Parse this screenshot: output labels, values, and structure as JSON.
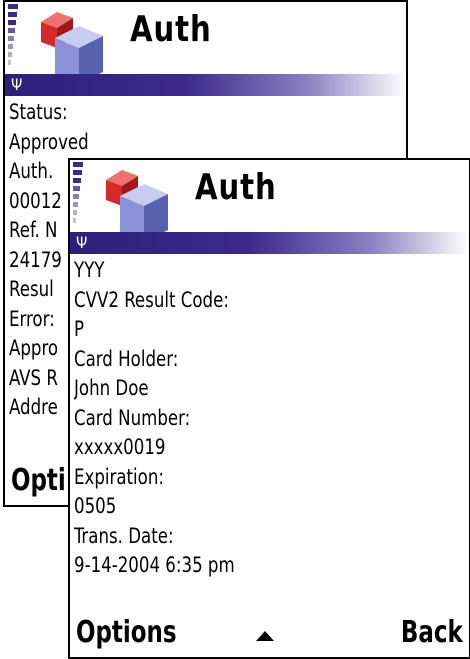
{
  "back_screen": {
    "title": "Auth",
    "lines": [
      "Status:",
      "Approved",
      "Auth.",
      "00012",
      "Ref. N",
      "24179",
      "Resul",
      "Error:",
      "Appro",
      "AVS R",
      "Addre"
    ],
    "softkey_left": "Opti"
  },
  "front_screen": {
    "title": "Auth",
    "lines": [
      "YYY",
      "CVV2 Result Code:",
      "P",
      "Card Holder:",
      "John Doe",
      "Card Number:",
      "xxxxx0019",
      "Expiration:",
      "0505",
      "Trans. Date:",
      "9-14-2004 6:35 pm"
    ],
    "softkey_left": "Options",
    "softkey_right": "Back"
  },
  "icons": {
    "app_icon": "cubes-icon",
    "signal": "signal-strength-icon",
    "antenna": "antenna-icon",
    "scroll": "scroll-up-arrow-icon"
  },
  "colors": {
    "accent": "#3b2a8c",
    "cube_red": "#d42a2a",
    "cube_blue": "#8c92d8"
  }
}
